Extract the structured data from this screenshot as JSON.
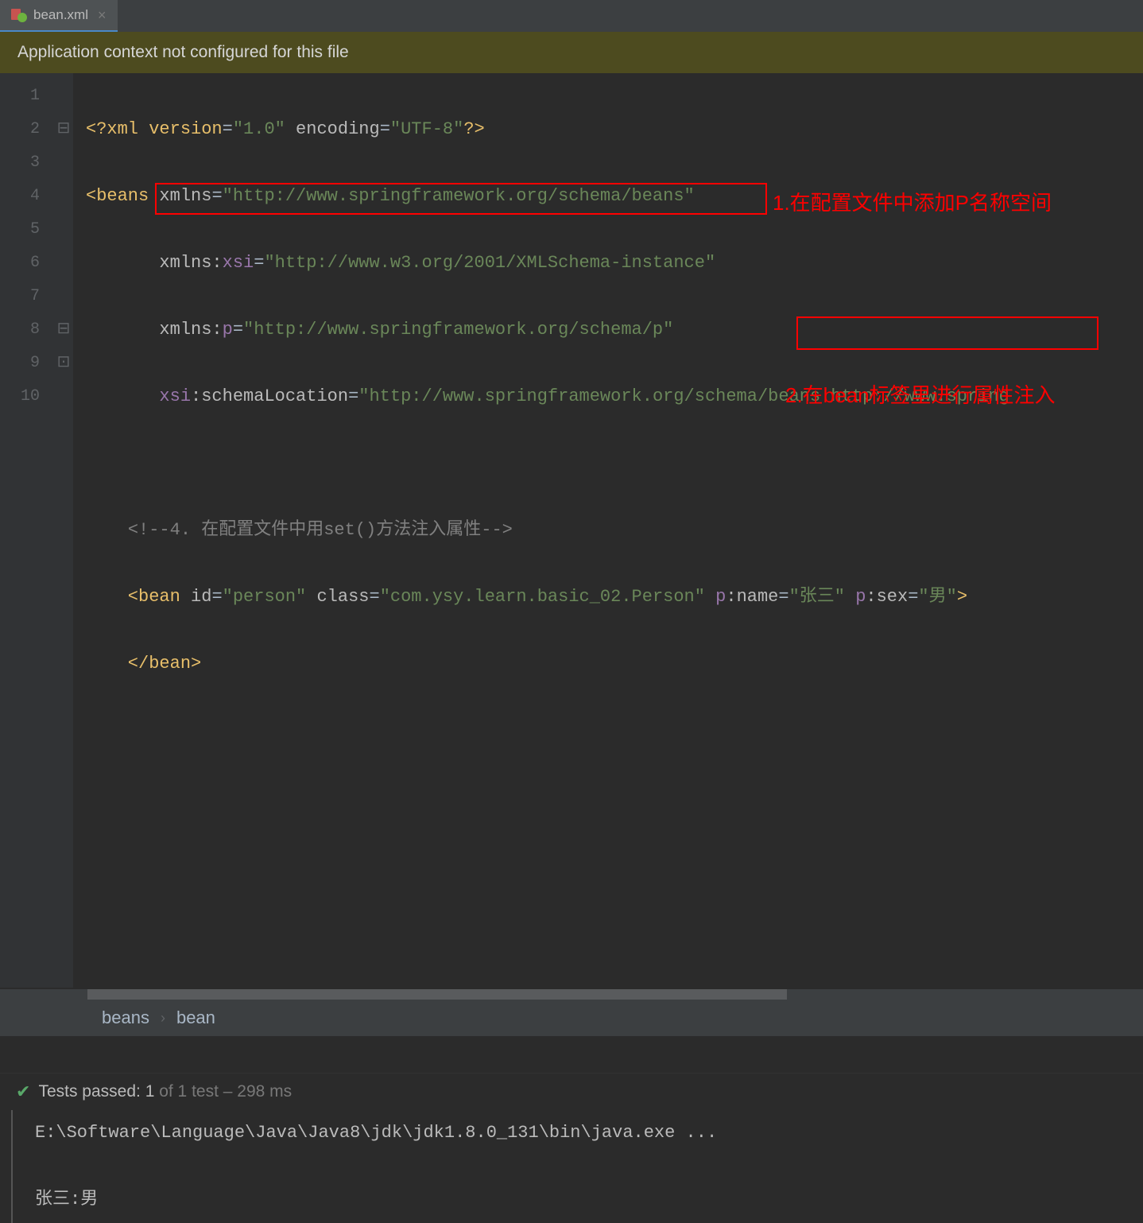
{
  "tab": {
    "filename": "bean.xml",
    "close": "×"
  },
  "banner": {
    "text": "Application context not configured for this file"
  },
  "lineNumbers": [
    "1",
    "2",
    "3",
    "4",
    "5",
    "6",
    "7",
    "8",
    "9",
    "10"
  ],
  "code": {
    "line1": {
      "p1": "<?",
      "p2": "xml version",
      "p3": "=",
      "p4": "\"1.0\"",
      "p5": " encoding",
      "p6": "=",
      "p7": "\"UTF-8\"",
      "p8": "?>"
    },
    "line2": {
      "p1": "<",
      "p2": "beans ",
      "p3": "xmlns",
      "p4": "=",
      "p5": "\"http://www.springframework.org/schema/beans\""
    },
    "line3": {
      "p1": "       ",
      "p2": "xmlns:",
      "p3": "xsi",
      "p4": "=",
      "p5": "\"http://www.w3.org/2001/XMLSchema-instance\""
    },
    "line4": {
      "p1": "       ",
      "p2": "xmlns:",
      "p3": "p",
      "p4": "=",
      "p5": "\"http://www.springframework.org/schema/p\""
    },
    "line5": {
      "p1": "       ",
      "p2": "xsi",
      "p3": ":schemaLocation",
      "p4": "=",
      "p5": "\"http://www.springframework.org/schema/beans http://www.spring"
    },
    "line7": {
      "p1": "    ",
      "p2": "<!--4. 在配置文件中用set()方法注入属性-->"
    },
    "line8": {
      "p1": "    <",
      "p2": "bean ",
      "p3": "id",
      "p4": "=",
      "p5": "\"person\"",
      "p6": " class",
      "p7": "=",
      "p8": "\"com.ysy.learn.basic_02.Person\"",
      "p9": " p",
      "p10": ":name",
      "p11": "=",
      "p12": "\"张三\"",
      "p13": " p",
      "p14": ":sex",
      "p15": "=",
      "p16": "\"男\"",
      "p17": ">"
    },
    "line9": {
      "p1": "    </",
      "p2": "bean",
      "p3": ">"
    }
  },
  "annotations": {
    "a1": "1.在配置文件中添加P名称空间",
    "a2": "2.在bean标签里进行属性注入"
  },
  "breadcrumb": {
    "b1": "beans",
    "sep": "›",
    "b2": "bean"
  },
  "testStatus": {
    "label": "Tests passed:",
    "count": "1",
    "of": " of 1 test – 298 ms"
  },
  "terminal": {
    "line1": "E:\\Software\\Language\\Java\\Java8\\jdk\\jdk1.8.0_131\\bin\\java.exe ...",
    "line2": "",
    "line3": "张三:男"
  }
}
